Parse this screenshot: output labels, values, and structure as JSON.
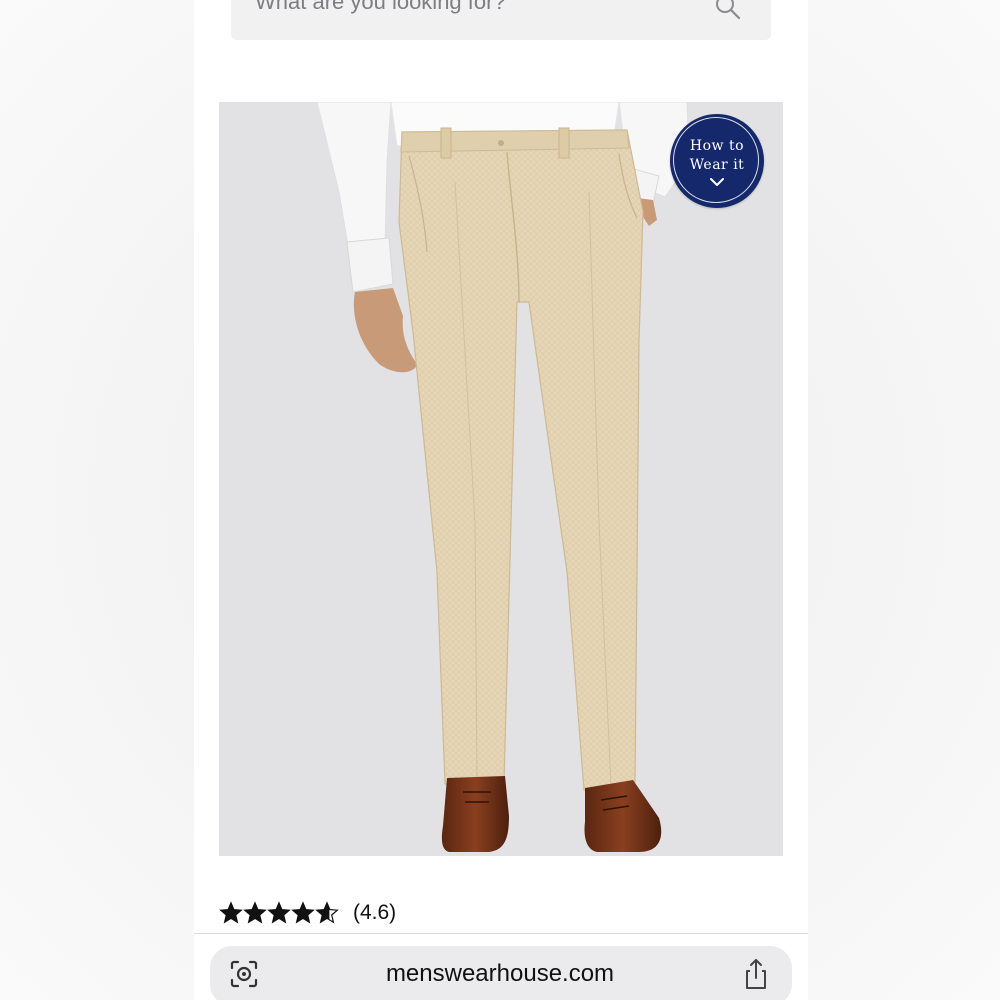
{
  "search": {
    "placeholder": "What are you looking for?",
    "icon": "search-icon"
  },
  "product": {
    "image_alt": "Men's tan linen dress pants",
    "badge": {
      "line1": "How to",
      "line2": "Wear it",
      "icon": "chevron-down-icon",
      "color": "#14286b"
    },
    "rating": {
      "value": 4.6,
      "max": 5,
      "text": "(4.6)"
    }
  },
  "browser": {
    "url": "menswearhouse.com",
    "left_icon": "visual-search-icon",
    "right_icon": "share-icon"
  }
}
